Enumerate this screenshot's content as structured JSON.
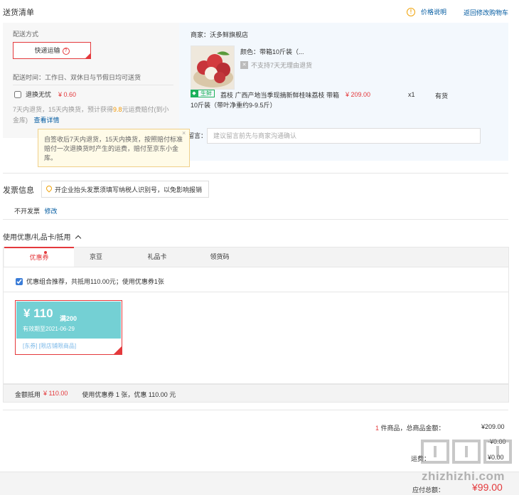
{
  "header": {
    "title": "送货清单",
    "price_note": "价格说明",
    "back_to_cart": "返回修改购物车"
  },
  "delivery": {
    "label": "配送方式",
    "method": "快递运输",
    "time": "配送时间：工作日、双休日与节假日均可送货",
    "return_option": "退换无忧",
    "return_price": "¥ 0.60",
    "note_prefix": "7天内退货，15天内换货，预计获得",
    "note_highlight": "9.8",
    "note_suffix": "元运费赔付(到小金库)",
    "details_link": "查看详情"
  },
  "tooltip": {
    "text": "自签收后7天内退货，15天内换货，按照赔付标准赔付一次退换货时产生的运费，赔付至京东小金库。",
    "close": "×"
  },
  "product": {
    "store": "商家：沃多鲜旗舰店",
    "color": "颜色：带箱10斤装（...",
    "no_return": "不支持7天无理由退货",
    "fresh_tag": "生鲜",
    "title": "荔枝 广西产地当季现摘新鲜桂味荔枝 带箱10斤装（带叶净重约9-9.5斤）",
    "price": "¥ 209.00",
    "qty": "x1",
    "stock": "有货",
    "remark_label": "留言：",
    "remark_placeholder": "建议留言前先与商家沟通确认"
  },
  "invoice": {
    "title": "发票信息",
    "tip": "开企业抬头发票须填写纳税人识别号，以免影响报销",
    "status": "不开发票",
    "modify": "修改"
  },
  "coupons": {
    "title": "使用优惠/礼品卡/抵用",
    "tabs": [
      "优惠券",
      "京豆",
      "礼品卡",
      "领货码"
    ],
    "combo_text": "优惠组合推荐，共抵用110.00元；使用优惠券1张",
    "card": {
      "amount": "¥ 110",
      "condition": "满200",
      "valid": "有效期至2021-06-29",
      "tags": "[东券] [限店铺限商品]"
    },
    "summary_label": "金额抵用",
    "summary_amount": "¥ 110.00",
    "summary_detail": "使用优惠券 1 张，优惠 110.00 元"
  },
  "totals": {
    "count_num": "1",
    "count_text": "件商品，总商品金额：",
    "goods_total": "¥209.00",
    "discount": "-¥0.00",
    "postage_label": "运费：",
    "postage": "¥0.00",
    "pay_label": "应付总额：",
    "pay_total": "¥99.00"
  },
  "watermark": {
    "text": "zhizhizhi.com"
  },
  "colors": {
    "accent": "#e4393c",
    "panel_blue": "#f3f8fd",
    "coupon_teal": "#74d0d4",
    "fresh_green": "#1cb15b"
  }
}
